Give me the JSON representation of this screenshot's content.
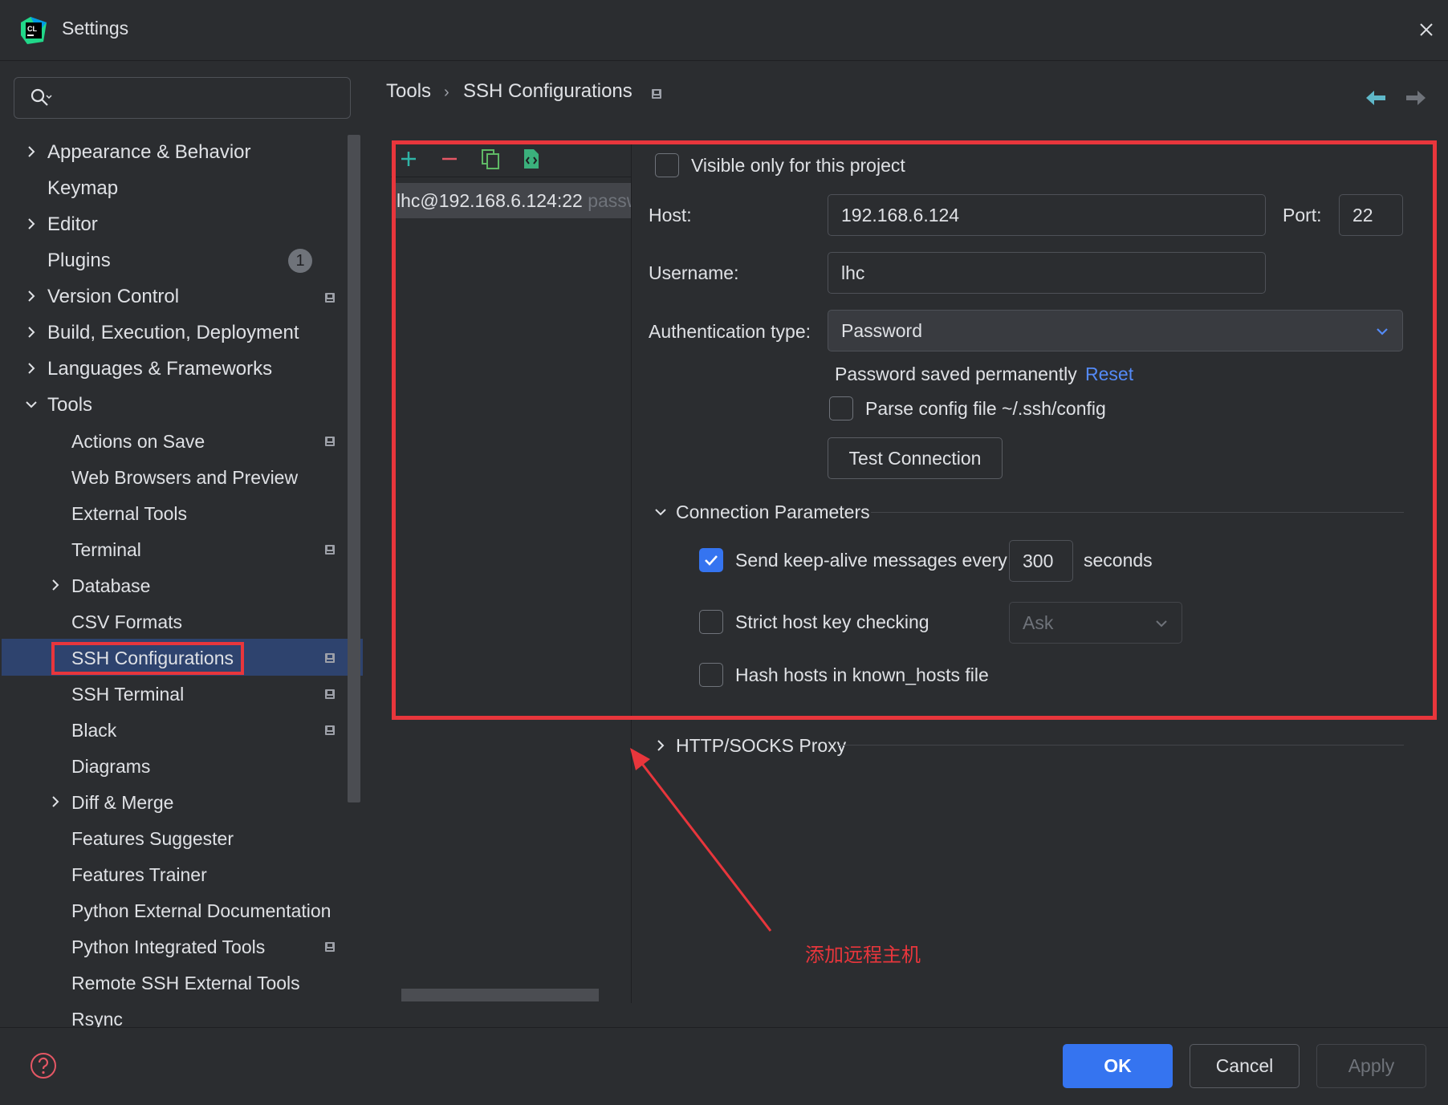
{
  "window": {
    "title": "Settings"
  },
  "search": {
    "placeholder": ""
  },
  "sidebar": {
    "items": [
      {
        "label": "Appearance & Behavior"
      },
      {
        "label": "Keymap"
      },
      {
        "label": "Editor"
      },
      {
        "label": "Plugins",
        "badge": "1"
      },
      {
        "label": "Version Control"
      },
      {
        "label": "Build, Execution, Deployment"
      },
      {
        "label": "Languages & Frameworks"
      },
      {
        "label": "Tools"
      },
      {
        "label": "Actions on Save"
      },
      {
        "label": "Web Browsers and Preview"
      },
      {
        "label": "External Tools"
      },
      {
        "label": "Terminal"
      },
      {
        "label": "Database"
      },
      {
        "label": "CSV Formats"
      },
      {
        "label": "SSH Configurations"
      },
      {
        "label": "SSH Terminal"
      },
      {
        "label": "Black"
      },
      {
        "label": "Diagrams"
      },
      {
        "label": "Diff & Merge"
      },
      {
        "label": "Features Suggester"
      },
      {
        "label": "Features Trainer"
      },
      {
        "label": "Python External Documentation"
      },
      {
        "label": "Python Integrated Tools"
      },
      {
        "label": "Remote SSH External Tools"
      },
      {
        "label": "Rsync"
      }
    ]
  },
  "breadcrumb": {
    "parent": "Tools",
    "separator": "›",
    "current": "SSH Configurations"
  },
  "ssh_list": {
    "entries": [
      {
        "host": "lhc@192.168.6.124:22",
        "auth": "passwo"
      }
    ]
  },
  "form": {
    "visible_only": {
      "label": "Visible only for this project",
      "checked": false
    },
    "host": {
      "label": "Host:",
      "value": "192.168.6.124"
    },
    "port": {
      "label": "Port:",
      "value": "22"
    },
    "username": {
      "label": "Username:",
      "value": "lhc"
    },
    "auth_type": {
      "label": "Authentication type:",
      "value": "Password"
    },
    "password_status": "Password saved permanently",
    "reset_link": "Reset",
    "parse_config": {
      "label": "Parse config file ~/.ssh/config",
      "checked": false
    },
    "test_connection": "Test Connection",
    "connection_params": {
      "title": "Connection Parameters",
      "keepalive": {
        "label": "Send keep-alive messages every",
        "value": "300",
        "unit": "seconds",
        "checked": true
      },
      "strict_host": {
        "label": "Strict host key checking",
        "value": "Ask",
        "checked": false
      },
      "hash_hosts": {
        "label": "Hash hosts in known_hosts file",
        "checked": false
      }
    },
    "proxy": {
      "title": "HTTP/SOCKS Proxy"
    }
  },
  "annotation": {
    "text": "添加远程主机"
  },
  "buttons": {
    "ok": "OK",
    "cancel": "Cancel",
    "apply": "Apply"
  },
  "colors": {
    "accent": "#3574f0",
    "highlight": "#e8363c",
    "link": "#548af7",
    "selection": "#2e436e"
  }
}
